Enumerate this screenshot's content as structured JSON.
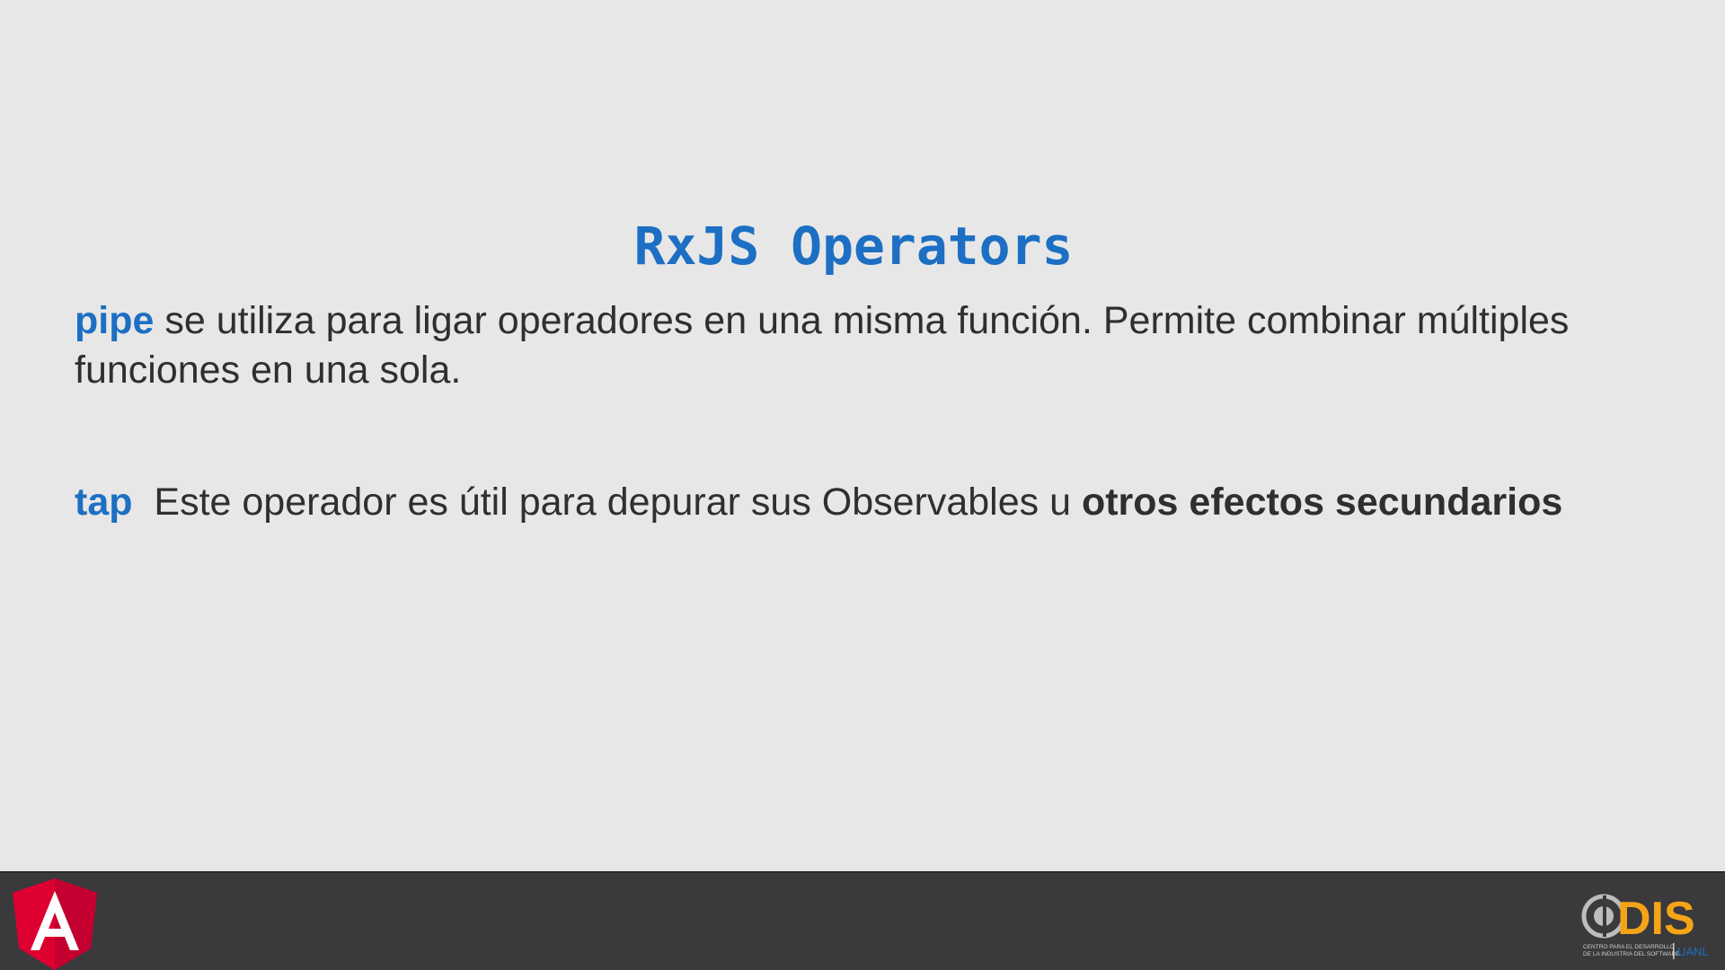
{
  "slide": {
    "title": "RxJS Operators",
    "paragraphs": [
      {
        "keyword": "pipe",
        "text": " se utiliza para ligar operadores en una misma función. Permite combinar múltiples funciones en una sola."
      },
      {
        "keyword": "tap",
        "text": "  Este operador es útil para depurar sus Observables u ",
        "emphasis": "otros efectos secundarios"
      }
    ]
  },
  "footer": {
    "left_logo": {
      "icon": "angular-logo",
      "letter": "A",
      "color": "#dd0031"
    },
    "right_logo": {
      "icon": "cdis-logo",
      "brand": "DIS",
      "caption_line1": "CENTRO PARA EL DESARROLLO",
      "caption_line2": "DE LA INDUSTRIA DEL SOFTWARE",
      "org": "UANL",
      "color": "#f4a417"
    },
    "background": "#3a393b"
  },
  "colors": {
    "background": "#e7e7e7",
    "accent": "#1c6fc3",
    "text": "#2f2f2f"
  }
}
